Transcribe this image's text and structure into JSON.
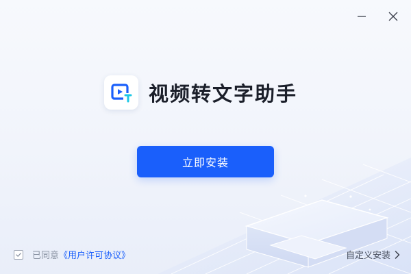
{
  "app": {
    "title": "视频转文字助手"
  },
  "window_controls": {
    "minimize_icon": "minimize-icon",
    "close_icon": "close-icon"
  },
  "main": {
    "install_button_label": "立即安装"
  },
  "footer": {
    "agreement_checked": true,
    "agree_prefix": "已同意",
    "license_link": "《用户许可协议》",
    "custom_install_label": "自定义安装",
    "custom_install_icon": "chevron-right-icon"
  },
  "colors": {
    "accent": "#1a5ffb",
    "background": "#f3f6fc",
    "title": "#1b1f2a",
    "muted_text": "#8a93a3"
  }
}
